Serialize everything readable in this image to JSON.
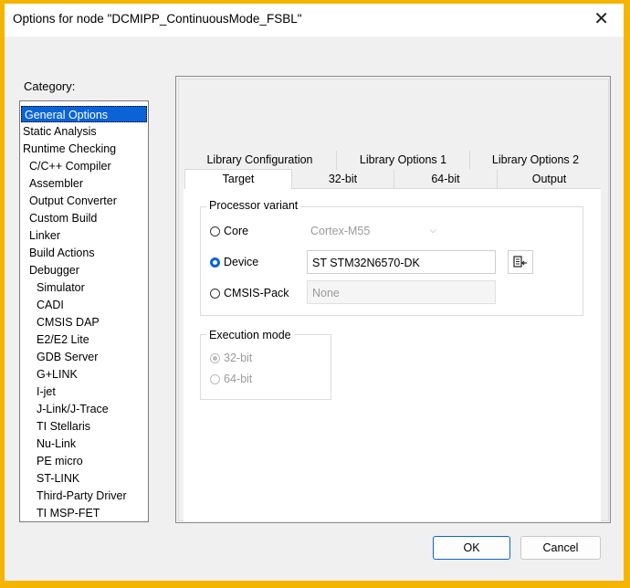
{
  "window": {
    "title": "Options for node \"DCMIPP_ContinuousMode_FSBL\"",
    "close_glyph": "✕"
  },
  "category": {
    "label": "Category:",
    "items": [
      {
        "label": "General Options",
        "indent": 0,
        "selected": true
      },
      {
        "label": "Static Analysis",
        "indent": 0
      },
      {
        "label": "Runtime Checking",
        "indent": 0
      },
      {
        "label": "C/C++ Compiler",
        "indent": 1
      },
      {
        "label": "Assembler",
        "indent": 1
      },
      {
        "label": "Output Converter",
        "indent": 1
      },
      {
        "label": "Custom Build",
        "indent": 1
      },
      {
        "label": "Linker",
        "indent": 1
      },
      {
        "label": "Build Actions",
        "indent": 1
      },
      {
        "label": "Debugger",
        "indent": 1
      },
      {
        "label": "Simulator",
        "indent": 2
      },
      {
        "label": "CADI",
        "indent": 2
      },
      {
        "label": "CMSIS DAP",
        "indent": 2
      },
      {
        "label": "E2/E2 Lite",
        "indent": 2
      },
      {
        "label": "GDB Server",
        "indent": 2
      },
      {
        "label": "G+LINK",
        "indent": 2
      },
      {
        "label": "I-jet",
        "indent": 2
      },
      {
        "label": "J-Link/J-Trace",
        "indent": 2
      },
      {
        "label": "TI Stellaris",
        "indent": 2
      },
      {
        "label": "Nu-Link",
        "indent": 2
      },
      {
        "label": "PE micro",
        "indent": 2
      },
      {
        "label": "ST-LINK",
        "indent": 2
      },
      {
        "label": "Third-Party Driver",
        "indent": 2
      },
      {
        "label": "TI MSP-FET",
        "indent": 2
      }
    ]
  },
  "tabs": {
    "top": [
      "Library Configuration",
      "Library Options 1",
      "Library Options 2"
    ],
    "bottom": [
      "Target",
      "32-bit",
      "64-bit",
      "Output"
    ],
    "active": "Target"
  },
  "processor": {
    "group_title": "Processor variant",
    "core_label": "Core",
    "core_value": "Cortex-M55",
    "device_label": "Device",
    "device_value": "ST STM32N6570-DK",
    "cmsis_label": "CMSIS-Pack",
    "cmsis_value": "None"
  },
  "execution": {
    "group_title": "Execution mode",
    "opt1": "32-bit",
    "opt2": "64-bit"
  },
  "buttons": {
    "ok": "OK",
    "cancel": "Cancel"
  },
  "colors": {
    "accent": "#0a64d8",
    "frame": "#f5b400"
  }
}
